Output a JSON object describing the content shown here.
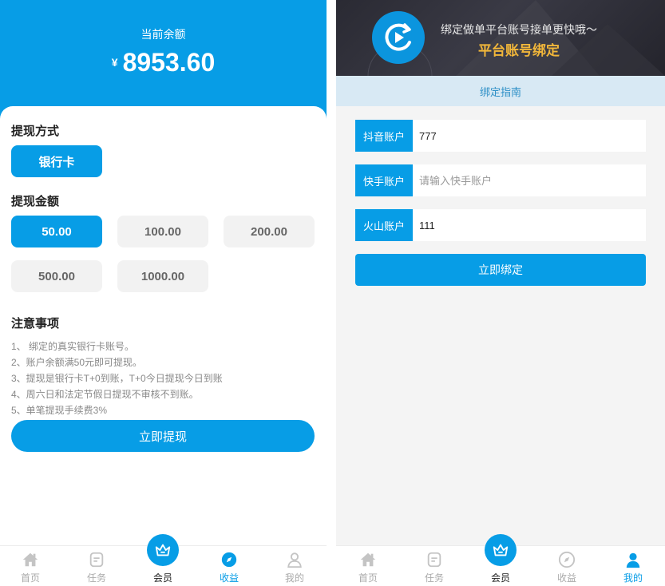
{
  "left": {
    "balance_label": "当前余额",
    "currency": "¥",
    "balance": "8953.60",
    "method_title": "提现方式",
    "method_option": "银行卡",
    "amount_title": "提现金额",
    "amounts": [
      "50.00",
      "100.00",
      "200.00",
      "500.00",
      "1000.00"
    ],
    "selected_amount": "50.00",
    "notes_title": "注意事项",
    "notes": [
      "1、 绑定的真实银行卡账号。",
      "2、账户余额满50元即可提现。",
      "3、提现是银行卡T+0到账，T+0今日提现今日到账",
      "4、周六日和法定节假日提现不审核不到账。",
      "5、单笔提现手续费3%"
    ],
    "withdraw_button": "立即提现",
    "tabs": [
      {
        "label": "首页",
        "icon": "home-icon"
      },
      {
        "label": "任务",
        "icon": "task-icon"
      },
      {
        "label": "会员",
        "icon": "crown-icon"
      },
      {
        "label": "收益",
        "icon": "compass-icon"
      },
      {
        "label": "我的",
        "icon": "user-icon"
      }
    ],
    "active_tab": "收益"
  },
  "right": {
    "banner_line1": "绑定做单平台账号接单更快哦～",
    "banner_line2": "平台账号绑定",
    "guide": "绑定指南",
    "fields": [
      {
        "label": "抖音账户",
        "value": "777",
        "placeholder": ""
      },
      {
        "label": "快手账户",
        "value": "",
        "placeholder": "请输入快手账户"
      },
      {
        "label": "火山账户",
        "value": "111",
        "placeholder": ""
      }
    ],
    "bind_button": "立即绑定",
    "tabs": [
      {
        "label": "首页",
        "icon": "home-icon"
      },
      {
        "label": "任务",
        "icon": "task-icon"
      },
      {
        "label": "会员",
        "icon": "crown-icon"
      },
      {
        "label": "收益",
        "icon": "compass-icon"
      },
      {
        "label": "我的",
        "icon": "user-icon"
      }
    ],
    "active_tab": "我的"
  },
  "colors": {
    "primary": "#079de6",
    "banner_accent": "#f2b73a",
    "guide_bg": "#d8e9f4",
    "chip_bg": "#f2f2f2",
    "tab_inactive": "#aaaaaa"
  }
}
